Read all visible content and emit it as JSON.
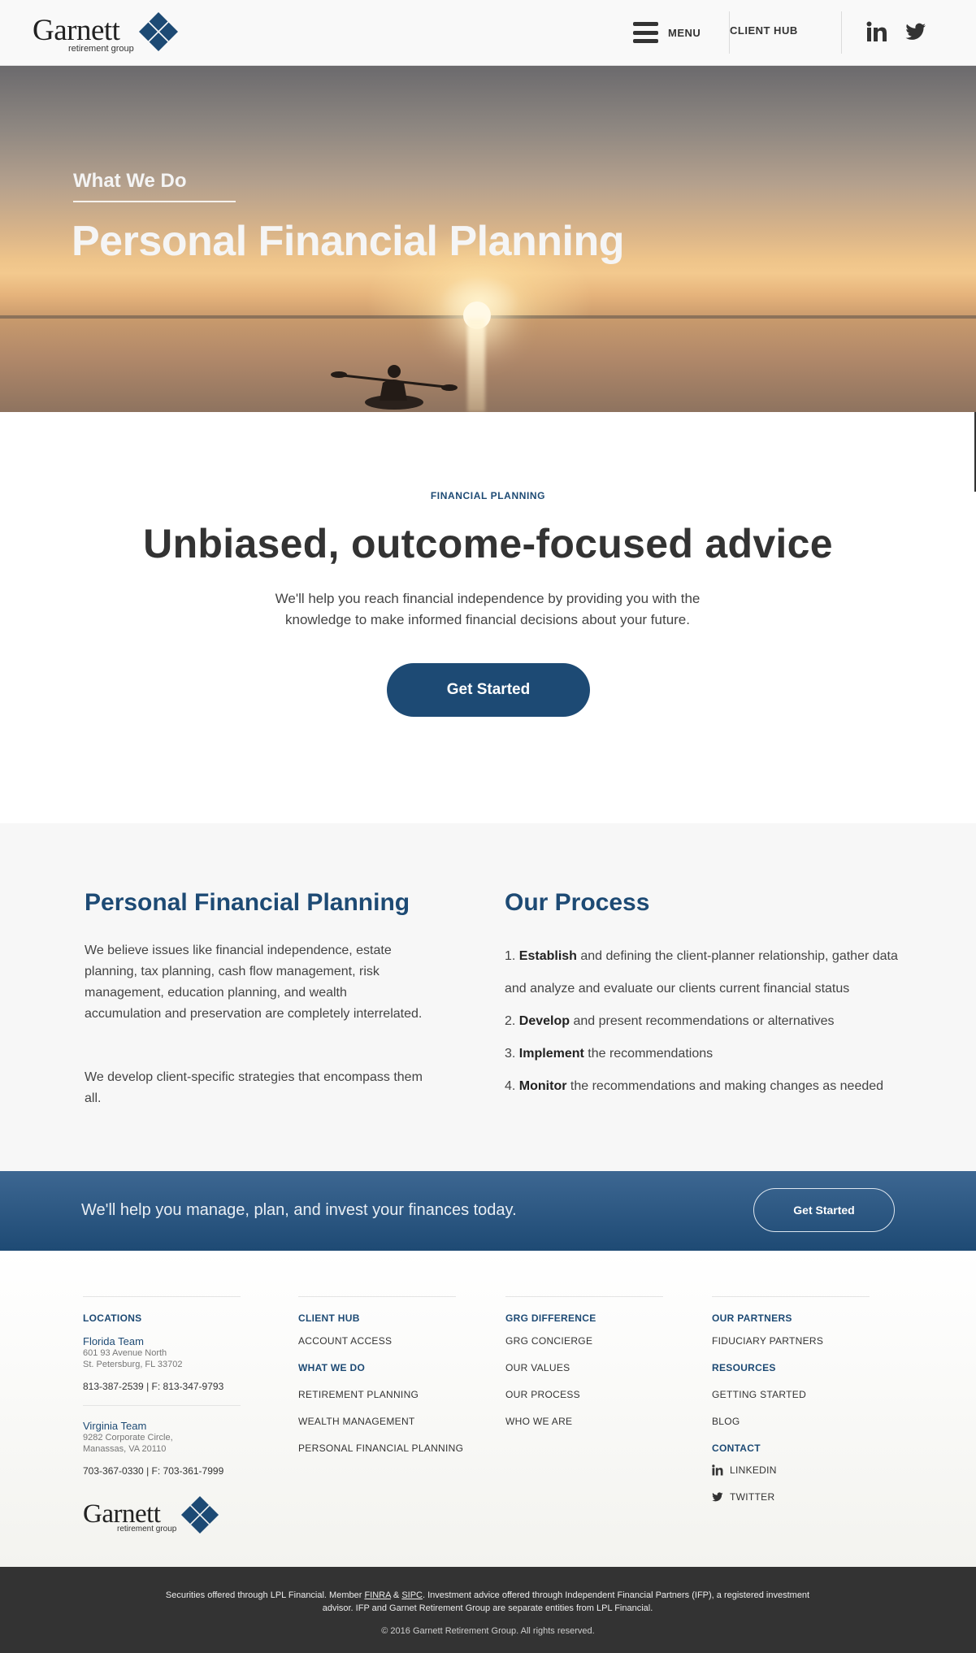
{
  "header": {
    "logo_word": "Garnett",
    "logo_sub": "retirement group",
    "menu_label": "MENU",
    "client_hub_label": "CLIENT HUB",
    "social": [
      "linkedin-icon",
      "twitter-icon"
    ]
  },
  "hero": {
    "subtitle": "What We Do",
    "title": "Personal Financial Planning"
  },
  "intro": {
    "eyebrow": "FINANCIAL PLANNING",
    "title": "Unbiased, outcome-focused advice",
    "text": "We'll help you reach financial independence by providing you with the knowledge to make informed financial decisions about your future.",
    "cta": "Get Started"
  },
  "info": {
    "left_title": "Personal Financial Planning",
    "left_p1": "We believe issues like financial independence, estate planning, tax planning, cash flow management, risk management, education planning, and wealth accumulation and preservation are completely interrelated.",
    "left_p2": "We develop client-specific strategies that encompass them all.",
    "right_title": "Our Process",
    "steps": [
      {
        "num": "1.",
        "bold": "Establish",
        "rest": " and defining the client-planner relationship, gather data"
      },
      {
        "num": "",
        "bold": "",
        "rest": "and analyze and evaluate our clients current financial status"
      },
      {
        "num": "2.",
        "bold": "Develop",
        "rest": " and present recommendations or alternatives"
      },
      {
        "num": "3.",
        "bold": "Implement",
        "rest": " the recommendations"
      },
      {
        "num": "4.",
        "bold": "Monitor",
        "rest": " the recommendations and making changes as needed"
      }
    ]
  },
  "banner": {
    "text": "We'll help you manage, plan, and invest your finances today.",
    "cta": "Get Started"
  },
  "footer": {
    "locations": {
      "heading": "LOCATIONS",
      "florida": {
        "name": "Florida Team",
        "addr1": "601 93 Avenue North",
        "addr2": "St. Petersburg, FL 33702",
        "phone": "813-387-2539 | F: 813-347-9793"
      },
      "virginia": {
        "name": "Virginia Team",
        "addr1": "9282 Corporate Circle,",
        "addr2": "Manassas, VA 20110",
        "phone": "703-367-0330 | F: 703-361-7999"
      }
    },
    "client_hub": {
      "heading": "CLIENT HUB",
      "account_access": "ACCOUNT ACCESS",
      "what_we_do_heading": "WHAT WE DO",
      "links": [
        "RETIREMENT PLANNING",
        "WEALTH MANAGEMENT",
        "PERSONAL FINANCIAL PLANNING"
      ]
    },
    "grg": {
      "heading": "GRG DIFFERENCE",
      "links": [
        "GRG CONCIERGE",
        "OUR VALUES",
        "OUR PROCESS",
        "WHO WE ARE"
      ]
    },
    "partners": {
      "heading": "OUR PARTNERS",
      "fiduciary": "FIDUCIARY PARTNERS",
      "resources_heading": "RESOURCES",
      "getting_started": "GETTING STARTED",
      "blog": "BLOG",
      "contact_heading": "CONTACT",
      "linkedin": "LINKEDIN",
      "twitter": "TWITTER"
    },
    "logo_word": "Garnett",
    "logo_sub": "retirement group"
  },
  "legal": {
    "part1": "Securities offered through LPL Financial. Member ",
    "finra": "FINRA",
    "amp": " & ",
    "sipc": "SIPC",
    "part2": ". Investment advice offered through Independent Financial Partners (IFP), a registered investment advisor.  IFP and Garnet Retirement Group are separate entities from LPL Financial.",
    "copyright": "© 2016 Garnett Retirement Group. All rights reserved."
  },
  "colors": {
    "brand_navy": "#1d4a74",
    "legal_bg": "#333333",
    "banner_top": "#3d6792",
    "banner_bottom": "#1e4a74"
  }
}
